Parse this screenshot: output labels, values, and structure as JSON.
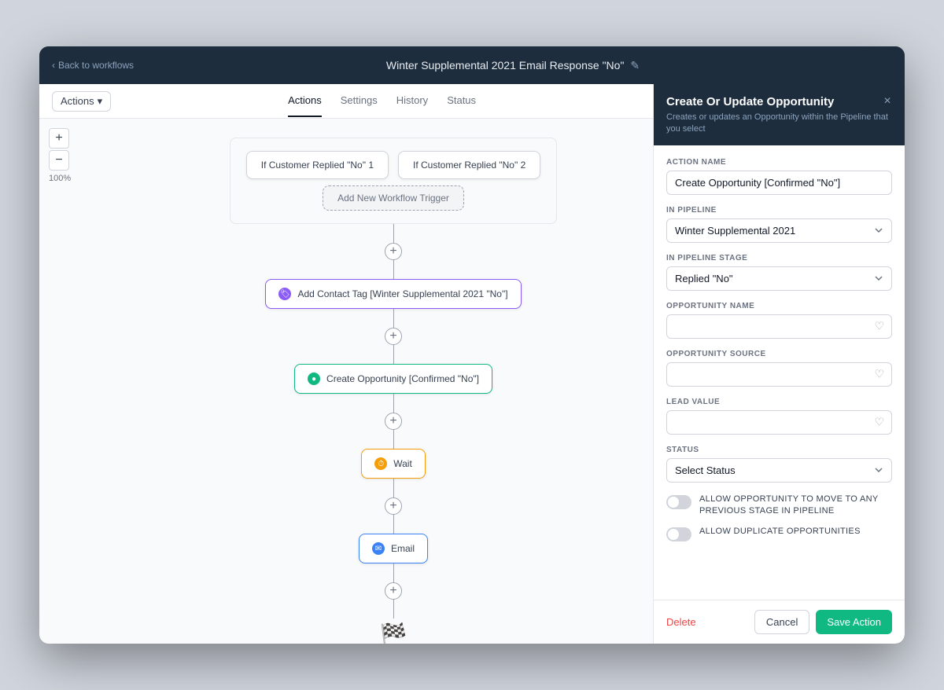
{
  "app": {
    "title": "Winter Supplemental 2021 Email Response \"No\"",
    "back_label": "Back to workflows"
  },
  "tabs": [
    {
      "id": "actions",
      "label": "Actions",
      "active": true
    },
    {
      "id": "settings",
      "label": "Settings",
      "active": false
    },
    {
      "id": "history",
      "label": "History",
      "active": false
    },
    {
      "id": "status",
      "label": "Status",
      "active": false
    }
  ],
  "canvas": {
    "zoom_label": "100%",
    "zoom_in_label": "+",
    "zoom_out_label": "−",
    "triggers": [
      {
        "id": "trigger1",
        "label": "If Customer Replied \"No\" 1"
      },
      {
        "id": "trigger2",
        "label": "If Customer Replied \"No\" 2"
      }
    ],
    "add_trigger_label": "Add New Workflow Trigger",
    "actions_btn_label": "Actions",
    "nodes": [
      {
        "id": "tag",
        "label": "Add Contact Tag [Winter Supplemental 2021 \"No\"]",
        "type": "tag",
        "icon_type": "purple",
        "icon": "🏷"
      },
      {
        "id": "opportunity",
        "label": "Create Opportunity [Confirmed \"No\"]",
        "type": "opportunity",
        "icon_type": "green",
        "icon": "●"
      },
      {
        "id": "wait",
        "label": "Wait",
        "type": "wait",
        "icon_type": "orange",
        "icon": "⏱"
      },
      {
        "id": "email",
        "label": "Email",
        "type": "email",
        "icon_type": "blue",
        "icon": "✉"
      }
    ]
  },
  "panel": {
    "title": "Create Or Update Opportunity",
    "subtitle": "Creates or updates an Opportunity within the Pipeline that you select",
    "fields": {
      "action_name_label": "ACTION NAME",
      "action_name_value": "Create Opportunity [Confirmed \"No\"]",
      "in_pipeline_label": "IN PIPELINE",
      "in_pipeline_value": "Winter Supplemental 2021",
      "in_pipeline_stage_label": "IN PIPELINE STAGE",
      "in_pipeline_stage_value": "Replied \"No\"",
      "opportunity_name_label": "OPPORTUNITY NAME",
      "opportunity_name_placeholder": "",
      "opportunity_source_label": "OPPORTUNITY SOURCE",
      "opportunity_source_placeholder": "",
      "lead_value_label": "LEAD VALUE",
      "lead_value_placeholder": "",
      "status_label": "STATUS",
      "status_placeholder": "Select Status"
    },
    "toggles": [
      {
        "id": "allow-previous-stage",
        "label": "ALLOW OPPORTUNITY TO MOVE TO ANY PREVIOUS STAGE IN PIPELINE",
        "active": false
      },
      {
        "id": "allow-duplicates",
        "label": "ALLOW DUPLICATE OPPORTUNITIES",
        "active": false
      }
    ],
    "footer": {
      "delete_label": "Delete",
      "cancel_label": "Cancel",
      "save_label": "Save Action"
    }
  }
}
